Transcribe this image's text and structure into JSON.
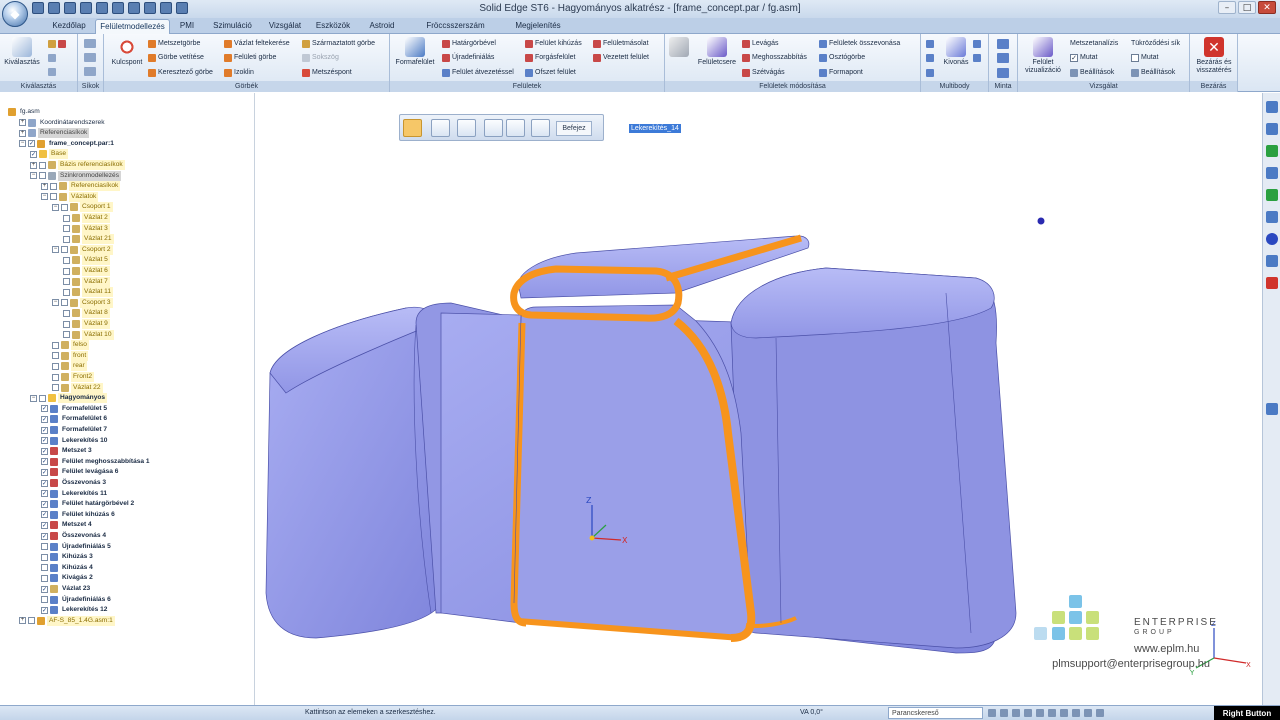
{
  "window": {
    "title": "Solid Edge ST6 - Hagyományos alkatrész - [frame_concept.par / fg.asm]",
    "controls": [
      "–",
      "□",
      "✕"
    ]
  },
  "tabs": [
    "Kezdőlap",
    "Felületmodellezés",
    "PMI",
    "Szimuláció",
    "Vizsgálat",
    "Eszközök",
    "Astroid",
    "Fröccsszerszám tervezés",
    "Megjelenítés"
  ],
  "active_tab": "Felületmodellezés",
  "ribbon": {
    "groups": {
      "kivalasztas": "Kiválasztás",
      "sikok": "Síkok",
      "gorbek": "Görbék",
      "feluletek": "Felületek",
      "feluletek_modositasa": "Felületek módosítása",
      "multibody": "Multibody",
      "minta": "Minta",
      "vizsgalat": "Vizsgálat",
      "bezaras": "Bezárás"
    },
    "buttons": {
      "kivalasztas": "Kiválasztás",
      "kulcspont": "Kulcspont",
      "metszetgorbe": "Metszetgörbe",
      "gorbe_vetitese": "Görbe vetítése",
      "keresztezo_gorbe": "Keresztező görbe",
      "vazlat_felterkezese": "Vázlat feltekerése",
      "feluleti_gorbe": "Felületi görbe",
      "izoklin": "Izoklin",
      "szarmaztatott_gorbe": "Származtatott görbe",
      "sokszog": "Sokszög",
      "metszespont": "Metszéspont",
      "formafelulet": "Formafelület",
      "hatargorbevel": "Határgörbével",
      "ujradefinialas": "Újradefiniálás",
      "felulet_atvezetessel": "Felület átvezetéssel",
      "felulet_kihuzas": "Felület kihúzás",
      "forgasfelulet": "Forgásfelület",
      "ofszet_felulet": "Ofszet felület",
      "feluletmasolat": "Felületmásolat",
      "vezetett_felulet": "Vezetett felület",
      "feluletcsere": "Felületcsere",
      "levagas": "Levágás",
      "meghosszabbitas": "Meghosszabbítás",
      "szetvagas": "Szétvágás",
      "feluletek_osszevonasa": "Felületek összevonása",
      "osztogorbe": "Osztógörbe",
      "formapont": "Formapont",
      "kivonas": "Kivonás",
      "felulet_vizualizacio": "Felület vizualizáció",
      "metszetanalizis": "Metszetanalízis",
      "tukrozodesi_sik": "Tükröződési sík",
      "mutat1": "Mutat",
      "beallitasok1": "Beállítások",
      "mutat2": "Mutat",
      "beallitasok2": "Beállítások",
      "bezaras_es_visszateres": "Bezárás és visszatérés"
    }
  },
  "tree": [
    {
      "indent": 0,
      "exp": "",
      "cb": "",
      "label": "fg.asm",
      "style": "plain",
      "icon": "#e0a030"
    },
    {
      "indent": 1,
      "exp": "+",
      "cb": "",
      "label": "Koordinátarendszerek",
      "style": "plain",
      "icon": "#8fa6c9"
    },
    {
      "indent": 1,
      "exp": "+",
      "cb": "",
      "label": "Referenciasíkok",
      "style": "gray",
      "icon": "#8fa6c9"
    },
    {
      "indent": 1,
      "exp": "−",
      "cb": "✓",
      "label": "frame_concept.par:1",
      "style": "bold",
      "icon": "#e0a030"
    },
    {
      "indent": 2,
      "exp": "",
      "cb": "✓",
      "label": "Base",
      "style": "yellow",
      "icon": "#f0c040"
    },
    {
      "indent": 2,
      "exp": "+",
      "cb": "",
      "label": "Bázis referenciasíkok",
      "style": "yellow",
      "icon": "#d0b060"
    },
    {
      "indent": 2,
      "exp": "−",
      "cb": "",
      "label": "Szinkronmodellezés",
      "style": "gray",
      "icon": "#9aa8b8"
    },
    {
      "indent": 3,
      "exp": "+",
      "cb": "",
      "label": "Referenciasíkok",
      "style": "yellow",
      "icon": "#d0b060"
    },
    {
      "indent": 3,
      "exp": "−",
      "cb": "",
      "label": "Vázlatok",
      "style": "yellow",
      "icon": "#d0b060"
    },
    {
      "indent": 4,
      "exp": "−",
      "cb": "",
      "label": "Csoport 1",
      "style": "yellow",
      "icon": "#d0b060"
    },
    {
      "indent": 5,
      "exp": "",
      "cb": "",
      "label": "Vázlat 2",
      "style": "yellow",
      "icon": "#d0b060"
    },
    {
      "indent": 5,
      "exp": "",
      "cb": "",
      "label": "Vázlat 3",
      "style": "yellow",
      "icon": "#d0b060"
    },
    {
      "indent": 5,
      "exp": "",
      "cb": "",
      "label": "Vázlat 21",
      "style": "yellow",
      "icon": "#d0b060"
    },
    {
      "indent": 4,
      "exp": "−",
      "cb": "",
      "label": "Csoport 2",
      "style": "yellow",
      "icon": "#d0b060"
    },
    {
      "indent": 5,
      "exp": "",
      "cb": "",
      "label": "Vázlat 5",
      "style": "yellow",
      "icon": "#d0b060"
    },
    {
      "indent": 5,
      "exp": "",
      "cb": "",
      "label": "Vázlat 6",
      "style": "yellow",
      "icon": "#d0b060"
    },
    {
      "indent": 5,
      "exp": "",
      "cb": "",
      "label": "Vázlat 7",
      "style": "yellow",
      "icon": "#d0b060"
    },
    {
      "indent": 5,
      "exp": "",
      "cb": "",
      "label": "Vázlat 11",
      "style": "yellow",
      "icon": "#d0b060"
    },
    {
      "indent": 4,
      "exp": "−",
      "cb": "",
      "label": "Csoport 3",
      "style": "yellow",
      "icon": "#d0b060"
    },
    {
      "indent": 5,
      "exp": "",
      "cb": "",
      "label": "Vázlat 8",
      "style": "yellow",
      "icon": "#d0b060"
    },
    {
      "indent": 5,
      "exp": "",
      "cb": "",
      "label": "Vázlat 9",
      "style": "yellow",
      "icon": "#d0b060"
    },
    {
      "indent": 5,
      "exp": "",
      "cb": "",
      "label": "Vázlat 10",
      "style": "yellow",
      "icon": "#d0b060"
    },
    {
      "indent": 4,
      "exp": "",
      "cb": "",
      "label": "felso",
      "style": "yellow",
      "icon": "#d0b060"
    },
    {
      "indent": 4,
      "exp": "",
      "cb": "",
      "label": "front",
      "style": "yellow",
      "icon": "#d0b060"
    },
    {
      "indent": 4,
      "exp": "",
      "cb": "",
      "label": "rear",
      "style": "yellow",
      "icon": "#d0b060"
    },
    {
      "indent": 4,
      "exp": "",
      "cb": "",
      "label": "Front2",
      "style": "yellow",
      "icon": "#d0b060"
    },
    {
      "indent": 4,
      "exp": "",
      "cb": "",
      "label": "Vázlat 22",
      "style": "yellow",
      "icon": "#d0b060"
    },
    {
      "indent": 2,
      "exp": "−",
      "cb": "",
      "label": "Hagyományos",
      "style": "bold-yellow",
      "icon": "#f0c040"
    },
    {
      "indent": 3,
      "exp": "",
      "cb": "✓",
      "label": "Formafelület 5",
      "style": "bold",
      "icon": "#5a80c8"
    },
    {
      "indent": 3,
      "exp": "",
      "cb": "✓",
      "label": "Formafelület 6",
      "style": "bold",
      "icon": "#5a80c8"
    },
    {
      "indent": 3,
      "exp": "",
      "cb": "✓",
      "label": "Formafelület 7",
      "style": "bold",
      "icon": "#5a80c8"
    },
    {
      "indent": 3,
      "exp": "",
      "cb": "✓",
      "label": "Lekerekítés 10",
      "style": "bold",
      "icon": "#5a80c8"
    },
    {
      "indent": 3,
      "exp": "",
      "cb": "✓",
      "label": "Metszet 3",
      "style": "bold",
      "icon": "#c84848"
    },
    {
      "indent": 3,
      "exp": "",
      "cb": "✓",
      "label": "Felület meghosszabbítása 1",
      "style": "bold",
      "icon": "#c84848"
    },
    {
      "indent": 3,
      "exp": "",
      "cb": "✓",
      "label": "Felület levágása 6",
      "style": "bold",
      "icon": "#c84848"
    },
    {
      "indent": 3,
      "exp": "",
      "cb": "✓",
      "label": "Összevonás 3",
      "style": "bold",
      "icon": "#c84848"
    },
    {
      "indent": 3,
      "exp": "",
      "cb": "✓",
      "label": "Lekerekítés 11",
      "style": "bold",
      "icon": "#5a80c8"
    },
    {
      "indent": 3,
      "exp": "",
      "cb": "✓",
      "label": "Felület határgörbével 2",
      "style": "bold",
      "icon": "#5a80c8"
    },
    {
      "indent": 3,
      "exp": "",
      "cb": "✓",
      "label": "Felület kihúzás 6",
      "style": "bold",
      "icon": "#5a80c8"
    },
    {
      "indent": 3,
      "exp": "",
      "cb": "✓",
      "label": "Metszet 4",
      "style": "bold",
      "icon": "#c84848"
    },
    {
      "indent": 3,
      "exp": "",
      "cb": "✓",
      "label": "Összevonás 4",
      "style": "bold",
      "icon": "#c84848"
    },
    {
      "indent": 3,
      "exp": "",
      "cb": "",
      "label": "Újradefiniálás 5",
      "style": "bold",
      "icon": "#5a80c8"
    },
    {
      "indent": 3,
      "exp": "",
      "cb": "",
      "label": "Kihúzás 3",
      "style": "bold",
      "icon": "#5a80c8"
    },
    {
      "indent": 3,
      "exp": "",
      "cb": "",
      "label": "Kihúzás 4",
      "style": "bold",
      "icon": "#5a80c8"
    },
    {
      "indent": 3,
      "exp": "",
      "cb": "",
      "label": "Kivágás 2",
      "style": "bold",
      "icon": "#5a80c8"
    },
    {
      "indent": 3,
      "exp": "",
      "cb": "✓",
      "label": "Vázlat 23",
      "style": "bold",
      "icon": "#d0b060"
    },
    {
      "indent": 3,
      "exp": "",
      "cb": "",
      "label": "Újradefiniálás 6",
      "style": "bold",
      "icon": "#5a80c8"
    },
    {
      "indent": 3,
      "exp": "",
      "cb": "✓",
      "label": "Lekerekítés 12",
      "style": "bold",
      "icon": "#5a80c8"
    },
    {
      "indent": 1,
      "exp": "+",
      "cb": "",
      "label": "AF-S_85_1.4G.asm:1",
      "style": "yellow",
      "icon": "#e0a030"
    }
  ],
  "viewport": {
    "edit_tag": "Lekerekítés_14",
    "command_bar_button": "Befejez",
    "axis": {
      "x": "X",
      "y": "Y",
      "z": "Z"
    }
  },
  "logo": {
    "name": "ENTERPRISE",
    "sub": "GROUP",
    "url": "www.eplm.hu",
    "email": "plmsupport@enterprisegroup.hu"
  },
  "status": {
    "prompt": "Kattintson az elemeken a szerkesztéshez.",
    "va": "VA 0,0°",
    "search_placeholder": "Parancskereső",
    "right_button": "Right Button"
  },
  "colors": {
    "model_face": "#8f94e4",
    "fillet": "#f7941d",
    "ribbon_bg": "#dbe6f3"
  }
}
